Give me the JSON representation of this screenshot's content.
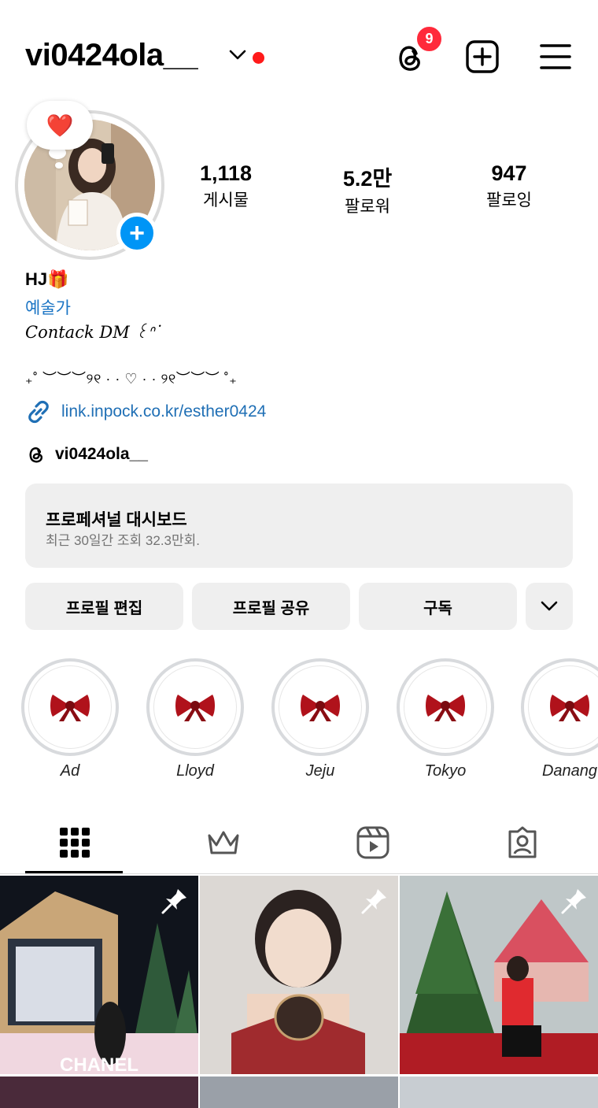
{
  "header": {
    "username": "vi0424ola__",
    "threads_badge": "9"
  },
  "profile": {
    "note_emoji": "❤️",
    "stats": [
      {
        "value": "1,118",
        "label": "게시물"
      },
      {
        "value": "5.2만",
        "label": "팔로워"
      },
      {
        "value": "947",
        "label": "팔로잉"
      }
    ],
    "name": "HJ🎁",
    "category": "예술가",
    "bio_line1": "Contack DM ꒰ᐢ˙",
    "bio_line2": "₊˚ ︶︶︶୨୧ · · ♡ · · ୨୧︶︶︶ ˚₊",
    "link": "link.inpock.co.kr/esther0424",
    "threads_handle": "vi0424ola__"
  },
  "dashboard": {
    "title": "프로페셔널 대시보드",
    "subtitle": "최근 30일간 조회 32.3만회."
  },
  "buttons": {
    "edit": "프로필 편집",
    "share": "프로필 공유",
    "subscribe": "구독"
  },
  "highlights": [
    {
      "label": "Ad"
    },
    {
      "label": "Lloyd"
    },
    {
      "label": "Jeju"
    },
    {
      "label": "Tokyo"
    },
    {
      "label": "Danang"
    }
  ],
  "tabs": [
    "grid-icon",
    "crown-icon",
    "reels-icon",
    "tagged-icon"
  ],
  "grid": {
    "post1_overlay": "CHANEL"
  },
  "colors": {
    "accent_blue": "#0095f6",
    "link_blue": "#1f6fb5",
    "badge_red": "#ff2a3b",
    "button_gray": "#efefef"
  }
}
